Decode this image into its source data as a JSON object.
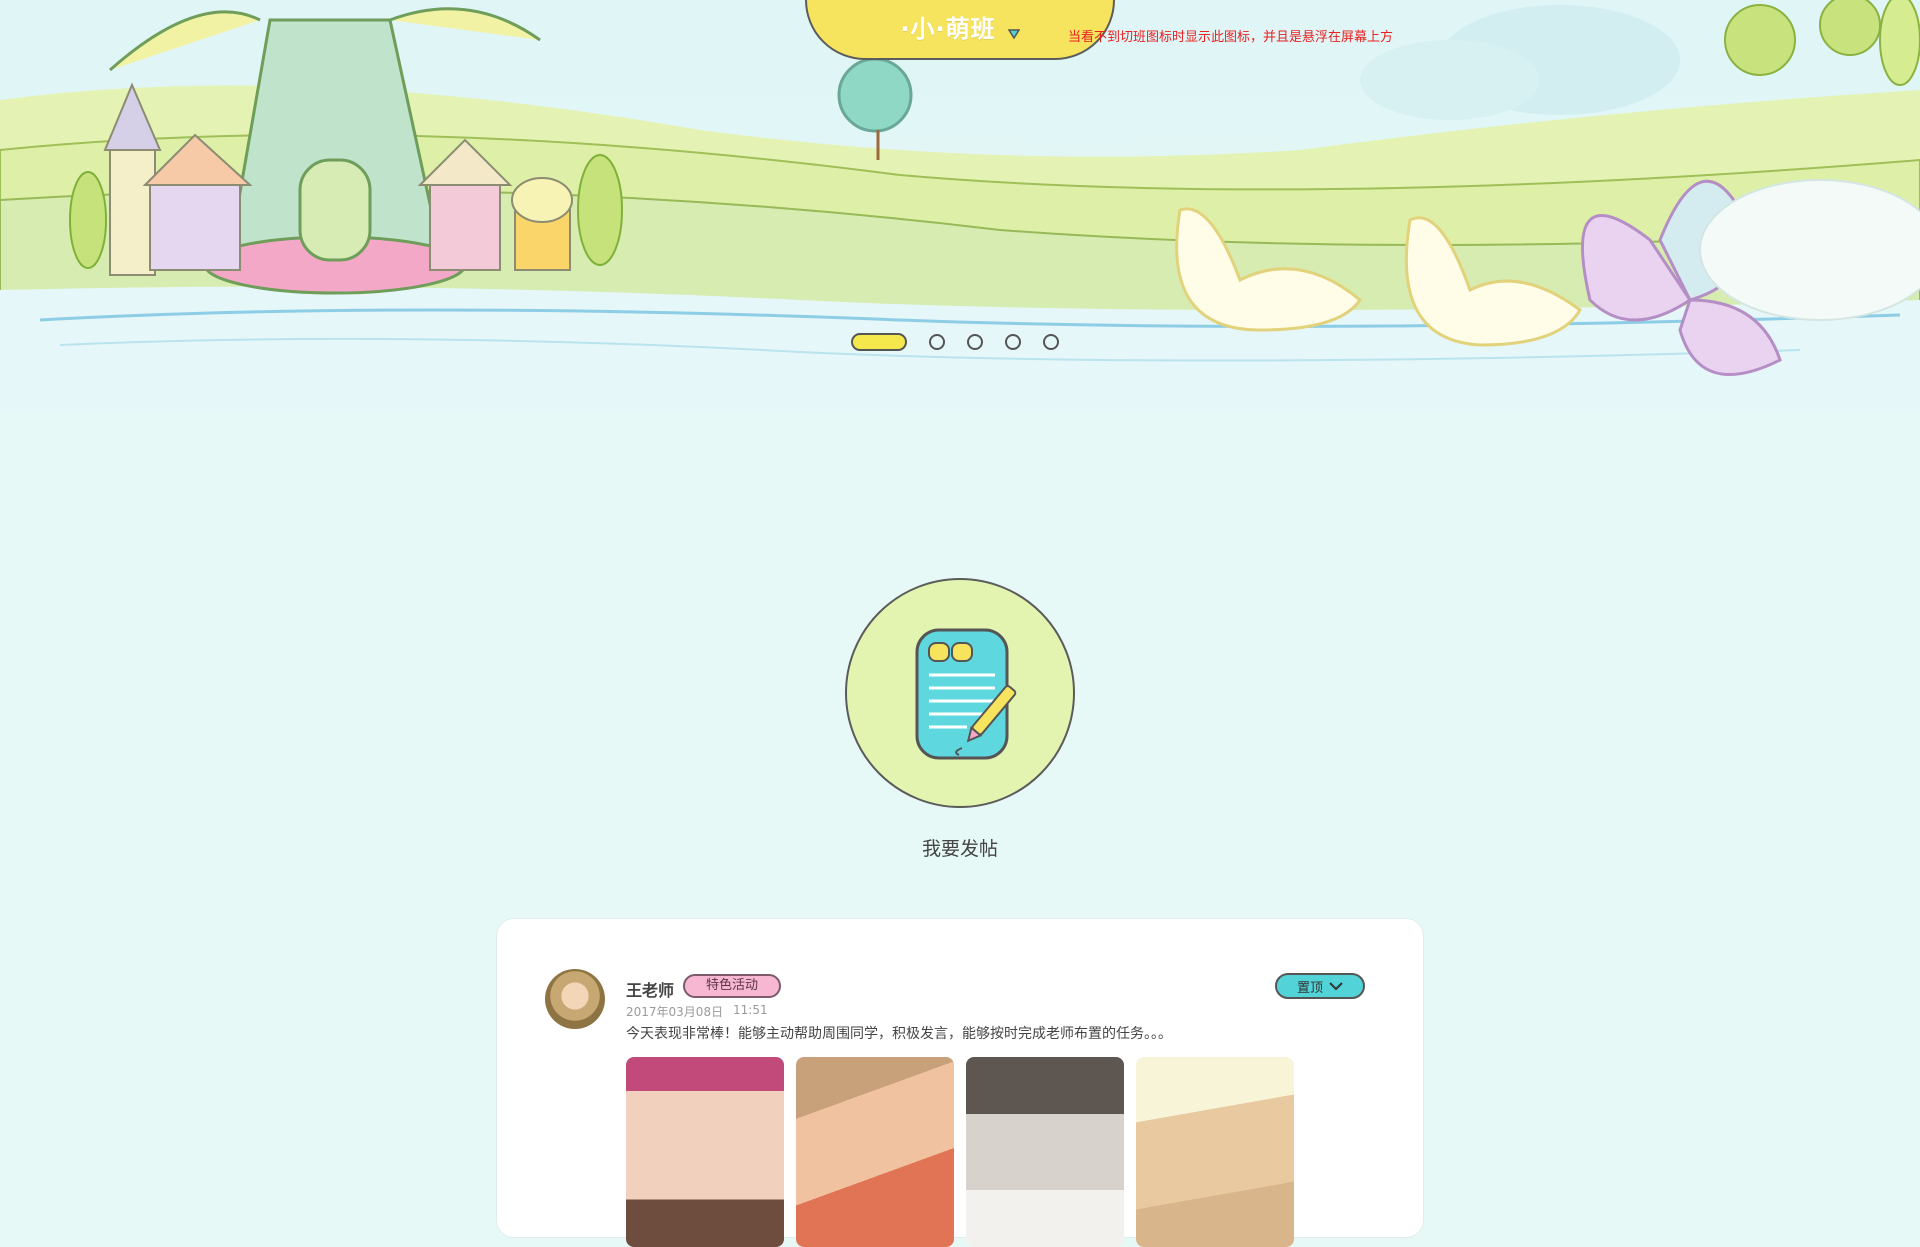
{
  "header": {
    "class_name": "·小·萌班",
    "notice": "当看不到切班图标时显示此图标，并且是悬浮在屏幕上方"
  },
  "carousel": {
    "slide_count": 5,
    "active_index": 0
  },
  "post_action": {
    "label": "我要发帖"
  },
  "feed": {
    "items": [
      {
        "author": "王老师",
        "tag": "特色活动",
        "date": "2017年03月08日",
        "time": "11:51",
        "content": "今天表现非常棒！能够主动帮助周围同学，积极发言，能够按时完成老师布置的任务。。。",
        "pin_label": "置顶"
      }
    ]
  },
  "colors": {
    "background": "#e6f9f7",
    "accent_yellow": "#f6e35e",
    "notice_red": "#e82020",
    "tag_pink": "#f7b7d3",
    "pin_cyan": "#52d3d8",
    "post_circle": "#e2f4b0",
    "note_icon": "#5ed8de"
  },
  "icons": [
    "caret-down-icon",
    "edit-note-icon",
    "chevron-down-icon"
  ]
}
